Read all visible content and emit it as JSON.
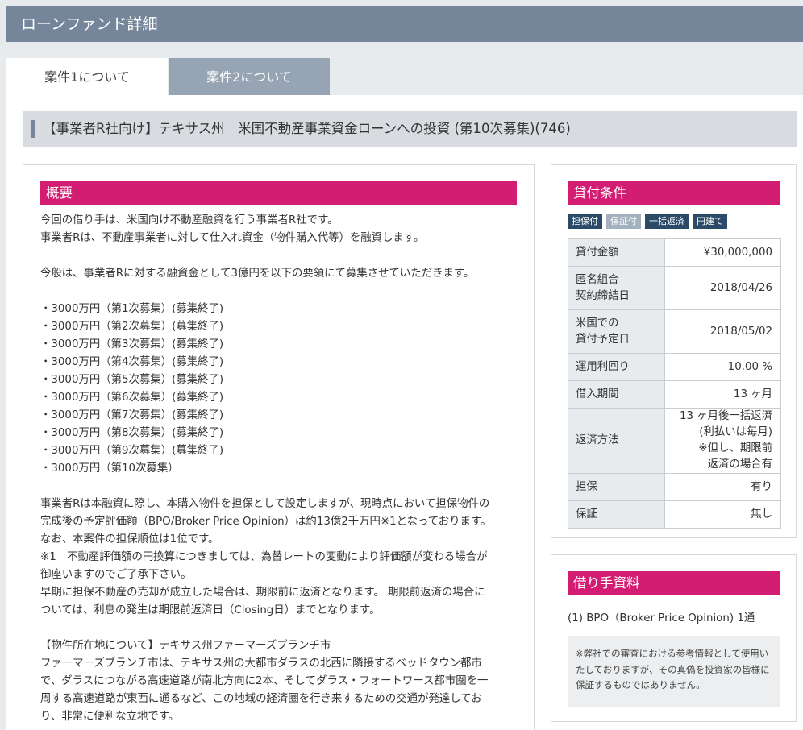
{
  "header": {
    "title": "ローンファンド詳細"
  },
  "tabs": [
    {
      "label": "案件1について"
    },
    {
      "label": "案件2について"
    }
  ],
  "fund_title": "【事業者R社向け】テキサス州　米国不動産事業資金ローンへの投資 (第10次募集)(746)",
  "overview": {
    "heading": "概要",
    "lines": [
      "今回の借り手は、米国向け不動産融資を行う事業者R社です。",
      "事業者Rは、不動産事業者に対して仕入れ資金（物件購入代等）を融資します。",
      "",
      "今般は、事業者Rに対する融資金として3億円を以下の要領にて募集させていただきます。",
      "",
      "・3000万円（第1次募集）(募集終了)",
      "・3000万円（第2次募集）(募集終了)",
      "・3000万円（第3次募集）(募集終了)",
      "・3000万円（第4次募集）(募集終了)",
      "・3000万円（第5次募集）(募集終了)",
      "・3000万円（第6次募集）(募集終了)",
      "・3000万円（第7次募集）(募集終了)",
      "・3000万円（第8次募集）(募集終了)",
      "・3000万円（第9次募集）(募集終了)",
      "・3000万円（第10次募集）",
      "",
      "事業者Rは本融資に際し、本購入物件を担保として設定しますが、現時点において担保物件の",
      "完成後の予定評価額（BPO/Broker Price Opinion）は約13億2千万円※1となっております。",
      "なお、本案件の担保順位は1位です。",
      "※1　不動産評価額の円換算につきましては、為替レートの変動により評価額が変わる場合が",
      "御座いますのでご了承下さい。",
      "早期に担保不動産の売却が成立した場合は、期限前に返済となります。 期限前返済の場合に",
      "ついては、利息の発生は期限前返済日（Closing日）までとなります。",
      "",
      "【物件所在地について】テキサス州ファーマーズブランチ市",
      "ファーマーズブランチ市は、テキサス州の大都市ダラスの北西に隣接するベッドタウン都市",
      "で、ダラスにつながる高速道路が南北方向に2本、そしてダラス・フォートワース都市圏を一",
      "周する高速道路が東西に通るなど、この地域の経済圏を行き来するための交通が発達してお",
      "り、非常に便利な立地です。"
    ]
  },
  "loan_terms": {
    "heading": "貸付条件",
    "badges": [
      {
        "label": "担保付",
        "style": "dark"
      },
      {
        "label": "保証付",
        "style": "light"
      },
      {
        "label": "一括返済",
        "style": "dark"
      },
      {
        "label": "円建て",
        "style": "dark"
      }
    ],
    "rows": [
      {
        "label": "貸付金額",
        "value": "¥30,000,000"
      },
      {
        "label": "匿名組合\n契約締結日",
        "value": "2018/04/26"
      },
      {
        "label": "米国での\n貸付予定日",
        "value": "2018/05/02"
      },
      {
        "label": "運用利回り",
        "value": "10.00 %"
      },
      {
        "label": "借入期間",
        "value": "13 ヶ月"
      },
      {
        "label": "返済方法",
        "value": "13 ヶ月後一括返済\n(利払いは毎月)\n※但し、期限前\n返済の場合有"
      },
      {
        "label": "担保",
        "value": "有り"
      },
      {
        "label": "保証",
        "value": "無し"
      }
    ]
  },
  "borrower_docs": {
    "heading": "借り手資料",
    "item": "(1) BPO（Broker Price Opinion) 1通",
    "note": "※弊社での審査における参考情報として使用いたしておりますが、その真偽を投資家の皆様に保証するものではありません。"
  },
  "colors": {
    "accent": "#d31d73",
    "header": "#76869a",
    "badge_dark": "#2a4a68",
    "badge_light": "#a3b0be"
  }
}
